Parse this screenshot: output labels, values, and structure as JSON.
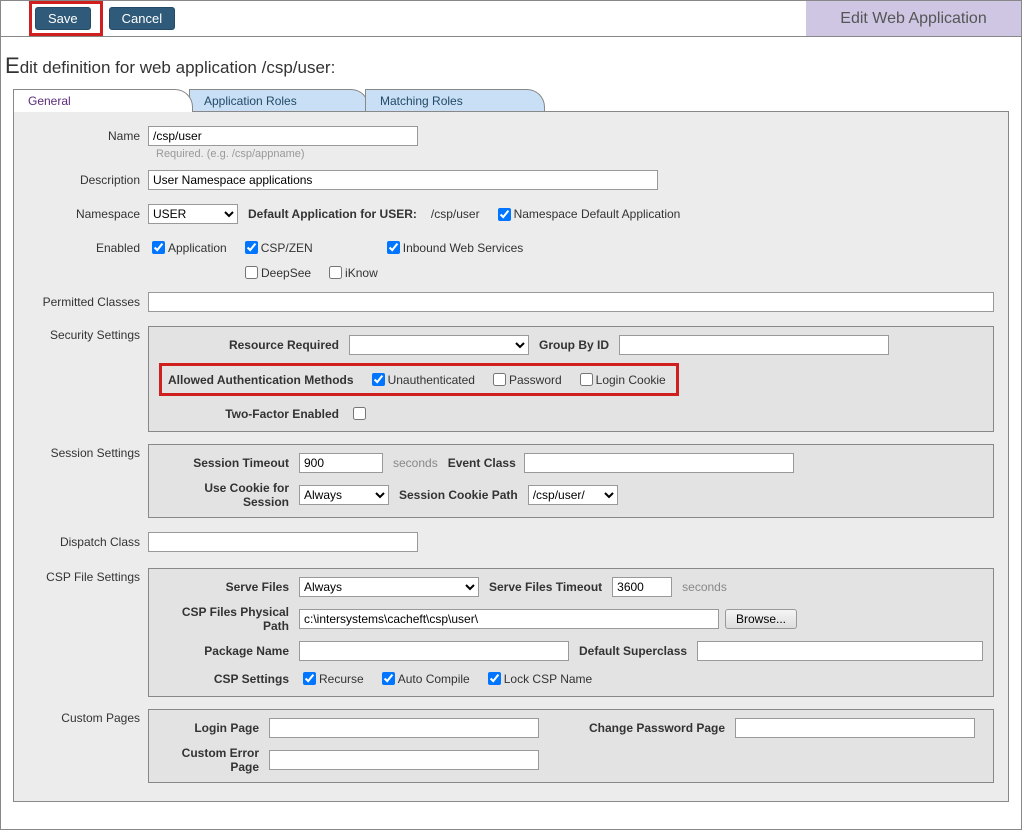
{
  "topbar": {
    "save": "Save",
    "cancel": "Cancel",
    "title": "Edit Web Application"
  },
  "heading_prefix": "E",
  "heading_rest": "dit definition for web application /csp/user:",
  "tabs": {
    "general": "General",
    "app_roles": "Application Roles",
    "matching": "Matching Roles"
  },
  "name": {
    "label": "Name",
    "value": "/csp/user",
    "hint": "Required. (e.g. /csp/appname)"
  },
  "description": {
    "label": "Description",
    "value": "User Namespace applications"
  },
  "namespace": {
    "label": "Namespace",
    "value": "USER",
    "default_app_label": "Default Application for USER:",
    "default_app_value": "/csp/user",
    "ns_default_label": "Namespace Default Application"
  },
  "enabled": {
    "label": "Enabled",
    "application": "Application",
    "cspzen": "CSP/ZEN",
    "inbound": "Inbound Web Services",
    "deepsee": "DeepSee",
    "iknow": "iKnow"
  },
  "permitted": {
    "label": "Permitted Classes"
  },
  "security": {
    "label": "Security Settings",
    "resource_required": "Resource Required",
    "group_by_id": "Group By ID",
    "auth_methods": "Allowed Authentication Methods",
    "unauth": "Unauthenticated",
    "password": "Password",
    "login_cookie": "Login Cookie",
    "two_factor": "Two-Factor Enabled"
  },
  "session": {
    "label": "Session Settings",
    "timeout": "Session Timeout",
    "timeout_value": "900",
    "seconds": "seconds",
    "event_class": "Event Class",
    "use_cookie": "Use Cookie for Session",
    "use_cookie_value": "Always",
    "cookie_path_label": "Session Cookie Path",
    "cookie_path_value": "/csp/user/"
  },
  "dispatch": {
    "label": "Dispatch Class"
  },
  "csp": {
    "label": "CSP File Settings",
    "serve_files": "Serve Files",
    "serve_files_value": "Always",
    "serve_files_timeout": "Serve Files Timeout",
    "serve_files_timeout_value": "3600",
    "seconds": "seconds",
    "phys_path": "CSP Files Physical Path",
    "phys_path_value": "c:\\intersystems\\cacheft\\csp\\user\\",
    "browse": "Browse...",
    "package_name": "Package Name",
    "default_superclass": "Default Superclass",
    "csp_settings": "CSP Settings",
    "recurse": "Recurse",
    "auto_compile": "Auto Compile",
    "lock_csp": "Lock CSP Name"
  },
  "custom": {
    "label": "Custom Pages",
    "login_page": "Login Page",
    "change_pw": "Change Password Page",
    "custom_error": "Custom Error Page"
  }
}
